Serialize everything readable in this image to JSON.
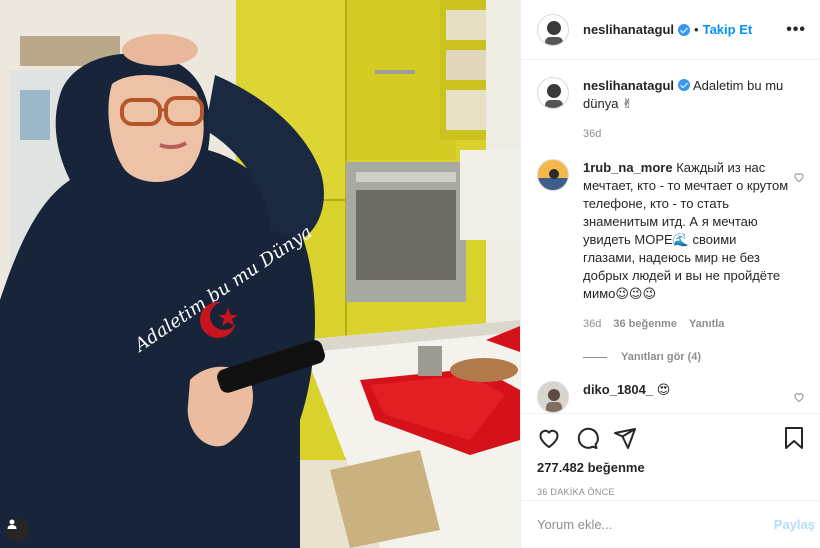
{
  "post": {
    "username": "neslihanatagul",
    "follow_label": "Takip Et",
    "more_label": "•••",
    "dot": "•"
  },
  "caption": {
    "username": "neslihanatagul",
    "text": "Adaletim bu mu dünya ✌",
    "age": "36d"
  },
  "comments": [
    {
      "username": "1rub_na_more",
      "text": "Каждый из нас мечтает, кто - то мечтает о крутом телефоне, кто - то стать знаменитым итд. А я мечтаю увидеть МОРЕ🌊 своими глазами, надеюсь мир не без добрых людей и вы не пройдёте мимо😉😉😉",
      "age": "36d",
      "likes": "36 beğenme",
      "reply": "Yanıtla",
      "view_replies": "Yanıtları gör (4)"
    },
    {
      "username": "diko_1804_",
      "text": "😍"
    }
  ],
  "stats": {
    "likes": "277.482 beğenme",
    "time": "36 DAKİKA ÖNCE"
  },
  "add_comment": {
    "placeholder": "Yorum ekle...",
    "post_label": "Paylaş"
  },
  "photo": {
    "hoodie_text": "Adaletim bu mu Dünya"
  },
  "colors": {
    "accent": "#0095f6",
    "verified": "#3897f0",
    "post_disabled": "#b2dffc",
    "hoodie": "#17243a",
    "cabinet": "#d8d02a",
    "tray": "#d8121a"
  },
  "icons": [
    "verified-icon",
    "more-icon",
    "heart-icon",
    "comment-icon",
    "share-icon",
    "bookmark-icon",
    "user-tag-icon"
  ]
}
